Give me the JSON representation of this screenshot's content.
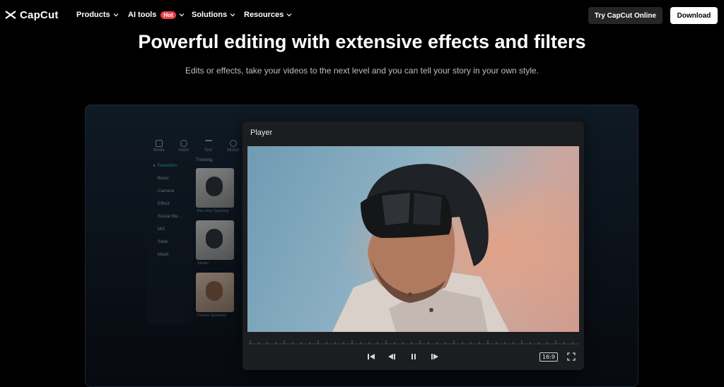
{
  "nav": {
    "brand": "CapCut",
    "menu": [
      {
        "label": "Products",
        "icon": "chevron-down-icon"
      },
      {
        "label": "AI tools",
        "badge": "Hot",
        "icon": "chevron-down-icon"
      },
      {
        "label": "Solutions",
        "icon": "chevron-down-icon"
      },
      {
        "label": "Resources",
        "icon": "chevron-down-icon"
      }
    ],
    "try_online": "Try CapCut Online",
    "download": "Download"
  },
  "hero": {
    "title": "Powerful editing with extensive effects and filters",
    "subtitle": "Edits or effects, take your videos to the next level and you can tell your story in your own style."
  },
  "editor": {
    "tabs": [
      "Media",
      "Audio",
      "Text",
      "Sticker"
    ],
    "active_category": "Transition",
    "categories": [
      "Basic",
      "Camera",
      "Effect",
      "Social Me...",
      "MG",
      "Slide",
      "Mask"
    ],
    "trending_label": "Trending",
    "thumbs": [
      "Blur-Hey Spinning",
      "Stutter",
      "Prisma Speckled"
    ]
  },
  "player": {
    "title": "Player",
    "aspect_ratio": "16:9",
    "icons": [
      "skip-back-icon",
      "step-back-icon",
      "pause-icon",
      "step-forward-icon",
      "fullscreen-icon"
    ]
  },
  "colors": {
    "accent": "#39c5bb",
    "hot_badge": "#e8404a"
  }
}
